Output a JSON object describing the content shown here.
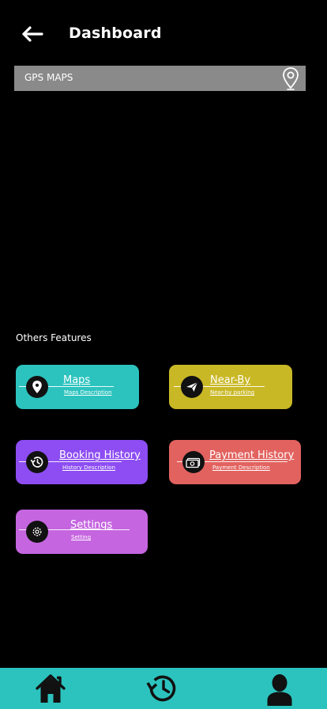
{
  "header": {
    "title": "Dashboard",
    "back_icon": "arrow-left-icon"
  },
  "map_bar": {
    "label": "GPS MAPS",
    "icon": "map-pin-outline-icon"
  },
  "section": {
    "title": "Others Features"
  },
  "features": {
    "maps": {
      "label": "Maps",
      "desc": "Maps Description",
      "icon": "location-pin-icon",
      "color": "#2cc3be"
    },
    "nearby": {
      "label": "Near-By",
      "desc": "Near-by parking",
      "icon": "send-icon",
      "color": "#c9b826"
    },
    "booking": {
      "label": "Booking History",
      "desc": "History Description",
      "icon": "history-icon",
      "color": "#8d4df2"
    },
    "payment": {
      "label": "Payment History",
      "desc": "Payment Description",
      "icon": "money-icon",
      "color": "#e2625f"
    },
    "settings": {
      "label": "Settings",
      "desc": "Setting",
      "icon": "gear-icon",
      "color": "#c565e0"
    }
  },
  "bottom_nav": {
    "color": "#2cc3be",
    "items": [
      {
        "icon": "home-icon"
      },
      {
        "icon": "history-icon"
      },
      {
        "icon": "user-icon"
      }
    ]
  }
}
